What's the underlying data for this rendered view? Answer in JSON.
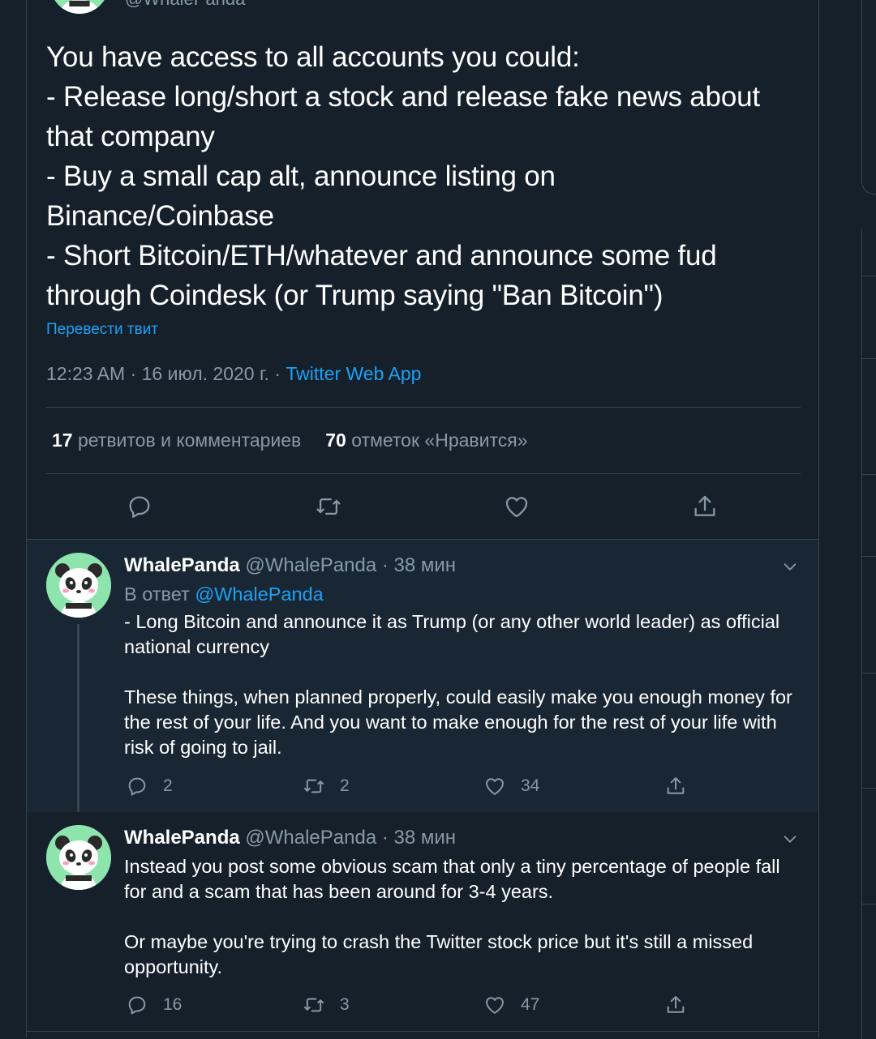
{
  "top_tweet": {
    "handle": "@WhalePanda",
    "lines": [
      "You have access to all accounts you could:",
      "- Release long/short a stock and release fake news about",
      "that company",
      "- Buy a small cap alt, announce listing on",
      "Binance/Coinbase",
      "- Short Bitcoin/ETH/whatever and announce some fud",
      "through Coindesk (or Trump saying \"Ban Bitcoin\")"
    ],
    "translate_label": "Перевести твит",
    "time": "12:23 AM",
    "date": "16 июл. 2020 г.",
    "dot": "·",
    "app": "Twitter Web App",
    "retweets_count": "17",
    "retweets_label": "ретвитов и комментариев",
    "likes_count": "70",
    "likes_label": "отметок «Нравится»",
    "actions": [
      "reply-icon",
      "retweet-icon",
      "like-icon",
      "share-icon"
    ]
  },
  "replies": [
    {
      "name": "WhalePanda",
      "handle": "@WhalePanda",
      "dot": "·",
      "time": "38 мин",
      "reply_to_prefix": "В ответ",
      "reply_to_handle": "@WhalePanda",
      "paragraph1": "- Long Bitcoin and announce it as Trump (or any other world leader) as official national currency",
      "paragraph2": "These things, when planned properly, could easily make you enough money for the rest of your life. And you want to make enough for the rest of your life with risk of going to jail.",
      "replies": "2",
      "retweets": "2",
      "likes": "34"
    },
    {
      "name": "WhalePanda",
      "handle": "@WhalePanda",
      "dot": "·",
      "time": "38 мин",
      "paragraph1": "Instead you post some obvious scam that only a tiny percentage of people fall for and a scam that has been around for 3-4 years.",
      "paragraph2": "Or maybe you're trying to crash the Twitter stock price but it's still a missed opportunity.",
      "replies": "16",
      "retweets": "3",
      "likes": "47"
    }
  ],
  "colors": {
    "background": "#15202b",
    "highlight": "#192734",
    "border": "#38444d",
    "muted": "#8899a6",
    "accent": "#1da1f2"
  }
}
